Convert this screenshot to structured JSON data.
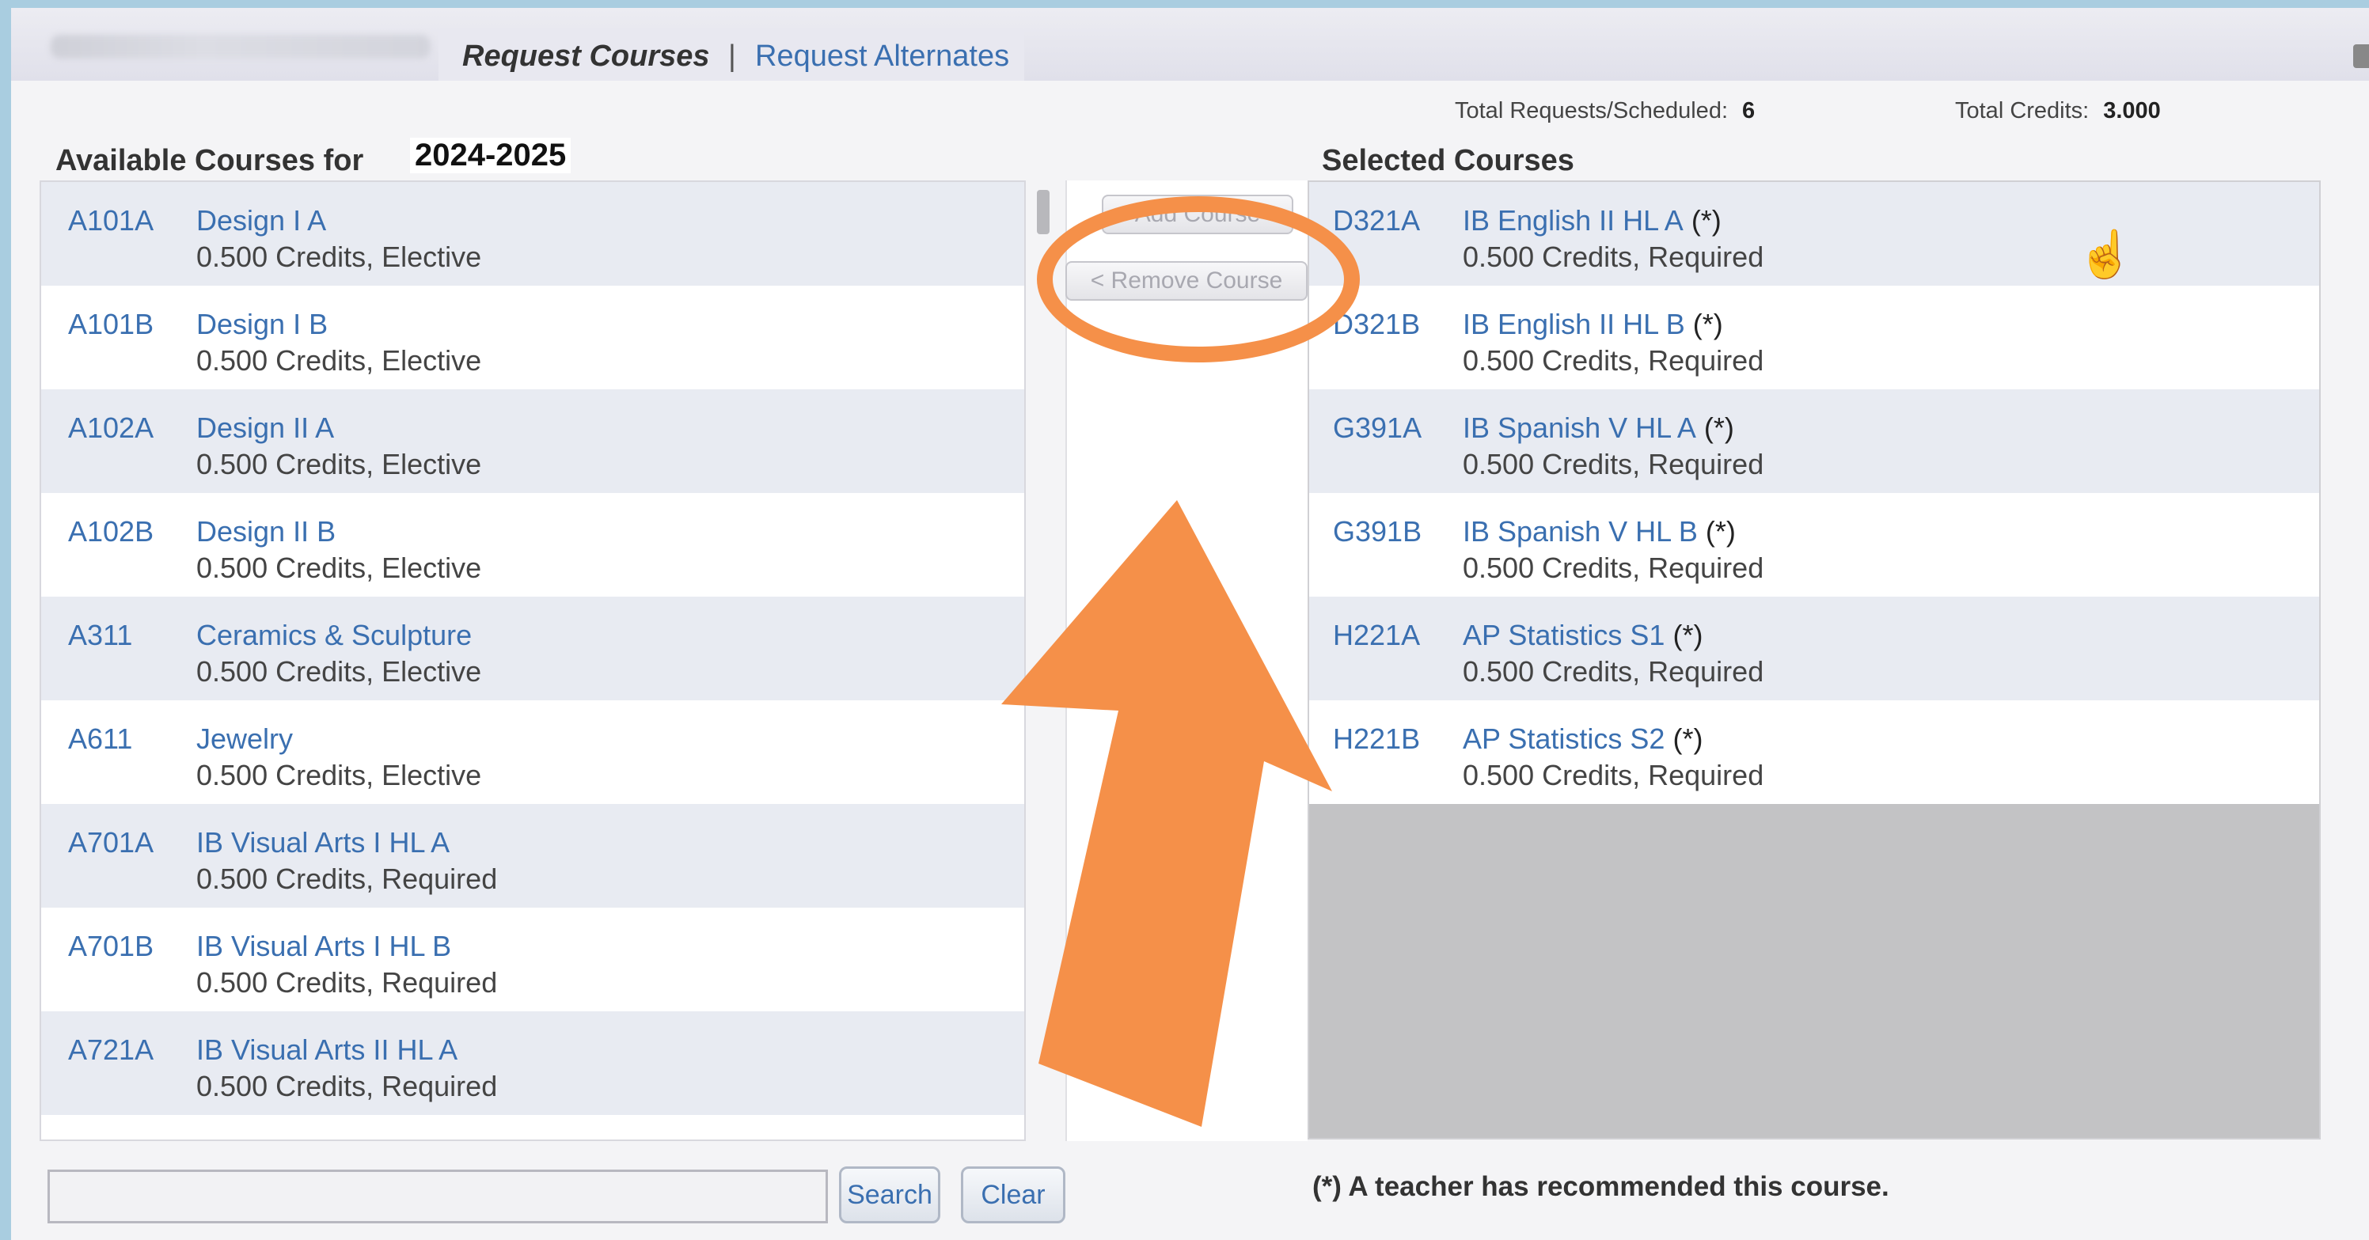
{
  "tabs": {
    "active": "Request Courses",
    "separator": "|",
    "other": "Request Alternates"
  },
  "stats": {
    "requests_label": "Total Requests/Scheduled:",
    "requests_value": "6",
    "credits_label": "Total Credits:",
    "credits_value": "3.000"
  },
  "available": {
    "title": "Available Courses for",
    "year": "2024-2025",
    "courses": [
      {
        "code": "A101A",
        "name": "Design I A",
        "detail": "0.500 Credits,  Elective"
      },
      {
        "code": "A101B",
        "name": "Design I B",
        "detail": "0.500 Credits,  Elective"
      },
      {
        "code": "A102A",
        "name": "Design II A",
        "detail": "0.500 Credits,  Elective"
      },
      {
        "code": "A102B",
        "name": "Design II B",
        "detail": "0.500 Credits,  Elective"
      },
      {
        "code": "A311",
        "name": "Ceramics & Sculpture",
        "detail": "0.500 Credits,  Elective"
      },
      {
        "code": "A611",
        "name": "Jewelry",
        "detail": "0.500 Credits,  Elective"
      },
      {
        "code": "A701A",
        "name": "IB Visual Arts I HL A",
        "detail": "0.500 Credits,  Required"
      },
      {
        "code": "A701B",
        "name": "IB Visual Arts I HL B",
        "detail": "0.500 Credits,  Required"
      },
      {
        "code": "A721A",
        "name": "IB Visual Arts II HL A",
        "detail": "0.500 Credits,  Required"
      }
    ]
  },
  "actions": {
    "add": "Add Course",
    "remove": "< Remove Course"
  },
  "selected": {
    "title": "Selected Courses",
    "courses": [
      {
        "code": "D321A",
        "name": "IB English II HL A",
        "rec": "(*)",
        "detail": "0.500 Credits,  Required"
      },
      {
        "code": "D321B",
        "name": "IB English II HL B",
        "rec": "(*)",
        "detail": "0.500 Credits,  Required"
      },
      {
        "code": "G391A",
        "name": "IB Spanish V HL A",
        "rec": "(*)",
        "detail": "0.500 Credits,  Required"
      },
      {
        "code": "G391B",
        "name": "IB Spanish V HL B",
        "rec": "(*)",
        "detail": "0.500 Credits,  Required"
      },
      {
        "code": "H221A",
        "name": "AP Statistics S1",
        "rec": "(*)",
        "detail": "0.500 Credits,  Required"
      },
      {
        "code": "H221B",
        "name": "AP Statistics S2",
        "rec": "(*)",
        "detail": "0.500 Credits,  Required"
      }
    ]
  },
  "search": {
    "placeholder": "",
    "search_label": "Search",
    "clear_label": "Clear"
  },
  "footnote": "(*) A teacher has recommended this course.",
  "colors": {
    "link": "#3a6fb0",
    "annotation": "#f59049",
    "row_alt": "#e8ebf2"
  }
}
